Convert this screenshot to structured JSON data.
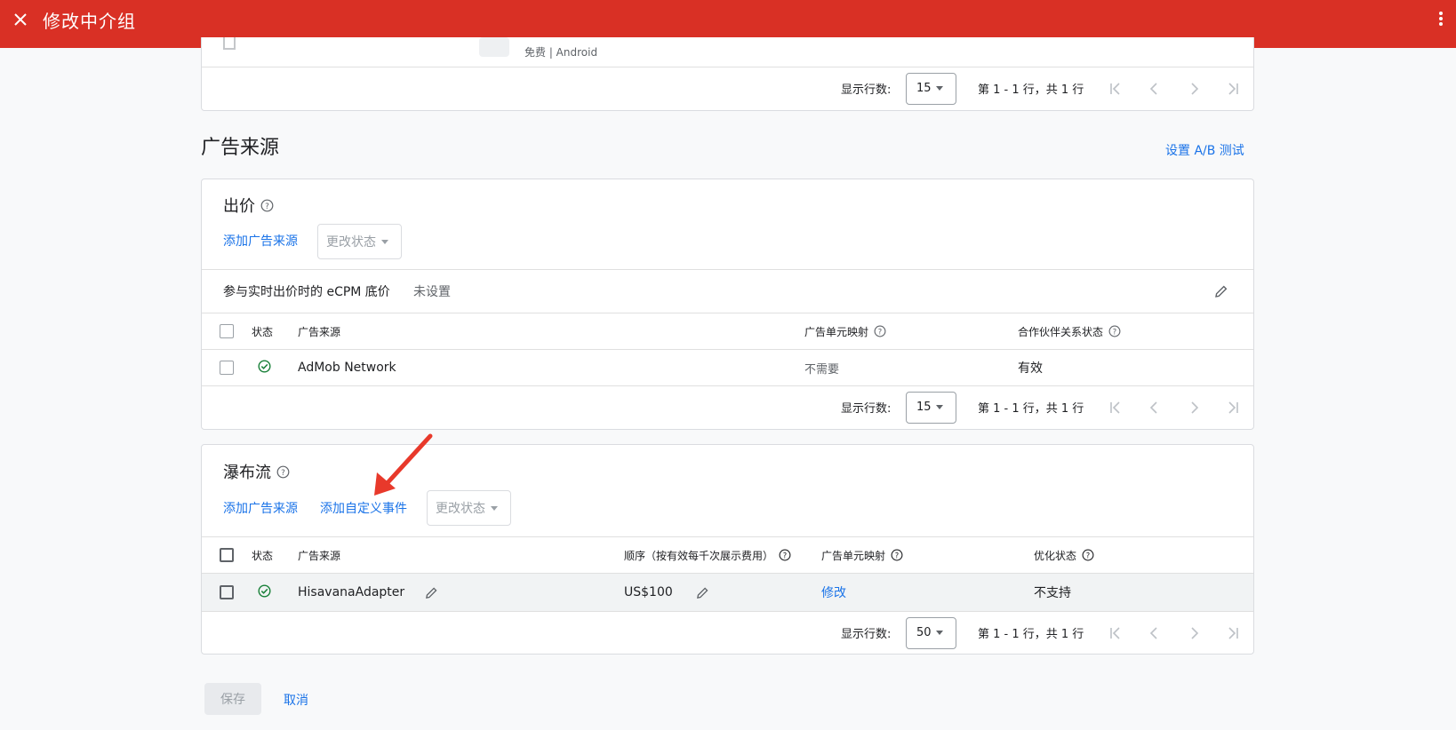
{
  "header": {
    "title": "修改中介组",
    "close_icon": "close-icon",
    "more_icon": "more-vert-icon"
  },
  "top_card": {
    "partial_text": "免费 | Android",
    "pager": {
      "rows_label": "显示行数:",
      "rows_value": "15",
      "range_text": "第 1 - 1 行，共 1 行"
    }
  },
  "ad_sources": {
    "title": "广告来源",
    "ab_test_link": "设置 A/B 测试"
  },
  "bidding": {
    "title": "出价",
    "add_source_link": "添加广告来源",
    "change_status": "更改状态",
    "ecpm_label": "参与实时出价时的 eCPM 底价",
    "ecpm_value": "未设置",
    "columns": {
      "status": "状态",
      "source": "广告来源",
      "mapping": "广告单元映射",
      "partner_status": "合作伙伴关系状态"
    },
    "rows": [
      {
        "source": "AdMob Network",
        "mapping": "不需要",
        "partner_status": "有效"
      }
    ],
    "pager": {
      "rows_label": "显示行数:",
      "rows_value": "15",
      "range_text": "第 1 - 1 行，共 1 行"
    }
  },
  "waterfall": {
    "title": "瀑布流",
    "add_source_link": "添加广告来源",
    "add_custom_event_link": "添加自定义事件",
    "change_status": "更改状态",
    "columns": {
      "status": "状态",
      "source": "广告来源",
      "order": "顺序（按有效每千次展示费用）",
      "mapping": "广告单元映射",
      "optimization": "优化状态"
    },
    "rows": [
      {
        "source": "HisavanaAdapter",
        "order": "US$100",
        "mapping_link": "修改",
        "optimization": "不支持"
      }
    ],
    "pager": {
      "rows_label": "显示行数:",
      "rows_value": "50",
      "range_text": "第 1 - 1 行，共 1 行"
    }
  },
  "footer": {
    "save": "保存",
    "cancel": "取消"
  },
  "colors": {
    "header_bg": "#d93025",
    "link": "#1a73e8",
    "status_ok": "#188038",
    "annotation_arrow": "#e8392b"
  }
}
